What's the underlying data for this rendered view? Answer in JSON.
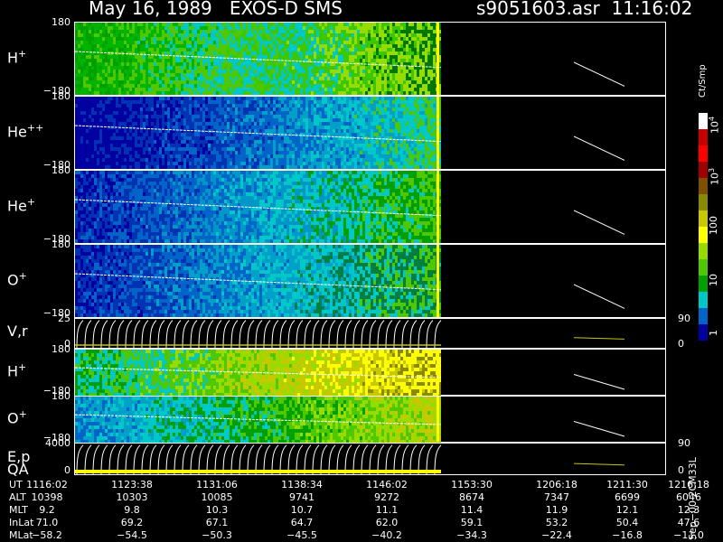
{
  "header": {
    "title": "May 16, 1989   EXOS-D SMS",
    "file": "s9051603.asr  11:16:02"
  },
  "panels": [
    {
      "label": "H",
      "charge": "+",
      "ymax": "180",
      "ymin": "−180",
      "type": "spectrogram",
      "palette": "green"
    },
    {
      "label": "He",
      "charge": "++",
      "ymax": "180",
      "ymin": "−180",
      "type": "spectrogram",
      "palette": "blue"
    },
    {
      "label": "He",
      "charge": "+",
      "ymax": "180",
      "ymin": "−180",
      "type": "spectrogram",
      "palette": "blue2"
    },
    {
      "label": "O",
      "charge": "+",
      "ymax": "180",
      "ymin": "−180",
      "type": "spectrogram",
      "palette": "blue3"
    },
    {
      "label": "V,r",
      "charge": "",
      "ymax": "25",
      "ymin": "0",
      "type": "line",
      "right_top": "90",
      "right_bottom": "0"
    },
    {
      "label": "H",
      "charge": "+",
      "ymax": "180",
      "ymin": "−180",
      "type": "spectrogram",
      "palette": "yellow"
    },
    {
      "label": "O",
      "charge": "+",
      "ymax": "180",
      "ymin": "−180",
      "type": "spectrogram",
      "palette": "mixed"
    },
    {
      "label": "E,p",
      "charge": "",
      "ymax": "4000",
      "ymin": "0",
      "type": "line",
      "right_top": "90",
      "right_bottom": "0",
      "sublabel": "QA"
    }
  ],
  "colorbar": {
    "unit": "Ct/Smp",
    "labels": [
      {
        "text": "10",
        "sup": "4"
      },
      {
        "text": "10",
        "sup": "3"
      },
      {
        "text": "100",
        "sup": ""
      },
      {
        "text": "10",
        "sup": ""
      },
      {
        "text": "1",
        "sup": ""
      }
    ],
    "colors": [
      "#ffffff",
      "#c80000",
      "#ff0000",
      "#a00000",
      "#805000",
      "#8a8a00",
      "#c8c800",
      "#ffff00",
      "#96dc00",
      "#50c800",
      "#00a000",
      "#00c8c8",
      "#0064c8",
      "#0000a0"
    ]
  },
  "chart_data": {
    "type": "heatmap",
    "title": "May 16, 1989   EXOS-D SMS",
    "x_axis": {
      "label": "UT",
      "ticks": [
        "1116:02",
        "1123:38",
        "1131:06",
        "1138:34",
        "1146:02",
        "1153:30",
        "1206:18",
        "1211:30",
        "1216:18"
      ]
    },
    "data_end_tick_index": 5,
    "rows": [
      {
        "name": "ALT",
        "values": [
          "10398",
          "10303",
          "10085",
          "9741",
          "9272",
          "8674",
          "7347",
          "6699",
          "6046"
        ]
      },
      {
        "name": "MLT",
        "values": [
          "9.2",
          "9.8",
          "10.3",
          "10.7",
          "11.1",
          "11.4",
          "11.9",
          "12.1",
          "12.3"
        ]
      },
      {
        "name": "InLat",
        "values": [
          "71.0",
          "69.2",
          "67.1",
          "64.7",
          "62.0",
          "59.1",
          "53.2",
          "50.4",
          "47.6"
        ]
      },
      {
        "name": "MLat",
        "values": [
          "−58.2",
          "−54.5",
          "−50.3",
          "−45.5",
          "−40.2",
          "−34.3",
          "−22.4",
          "−16.8",
          "−11.0"
        ]
      }
    ]
  },
  "footer": "Sep−00  2CM33L"
}
